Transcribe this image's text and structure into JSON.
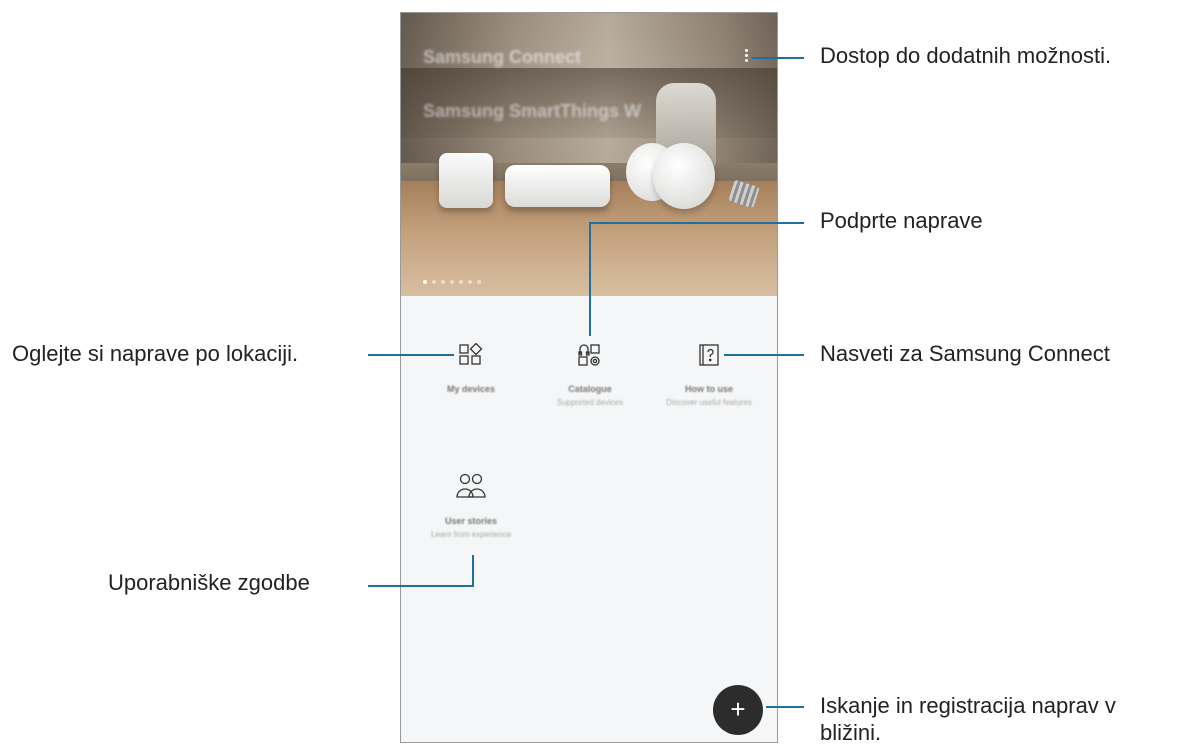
{
  "phone": {
    "hero": {
      "title": "Samsung Connect",
      "subtitle": "Samsung SmartThings W"
    },
    "tiles": [
      {
        "id": "my-devices",
        "title": "My devices",
        "subtitle": "",
        "icon": "grid-diamond-icon"
      },
      {
        "id": "catalogue",
        "title": "Catalogue",
        "subtitle": "Supported devices",
        "icon": "device-catalogue-icon"
      },
      {
        "id": "how-to-use",
        "title": "How to use",
        "subtitle": "Discover useful features",
        "icon": "help-book-icon"
      },
      {
        "id": "user-stories",
        "title": "User stories",
        "subtitle": "Learn from experience",
        "icon": "people-icon"
      }
    ],
    "fab_symbol": "+"
  },
  "callouts": {
    "more_options": "Dostop do dodatnih možnosti.",
    "supported_devices": "Podprte naprave",
    "devices_by_location": "Oglejte si naprave po lokaciji.",
    "tips": "Nasveti za Samsung Connect",
    "user_stories": "Uporabniške zgodbe",
    "search_register_line1": "Iskanje in registracija naprav v",
    "search_register_line2": "bližini."
  },
  "colors": {
    "callout_line": "#1f6fa0",
    "fab": "#2c2c2c"
  }
}
